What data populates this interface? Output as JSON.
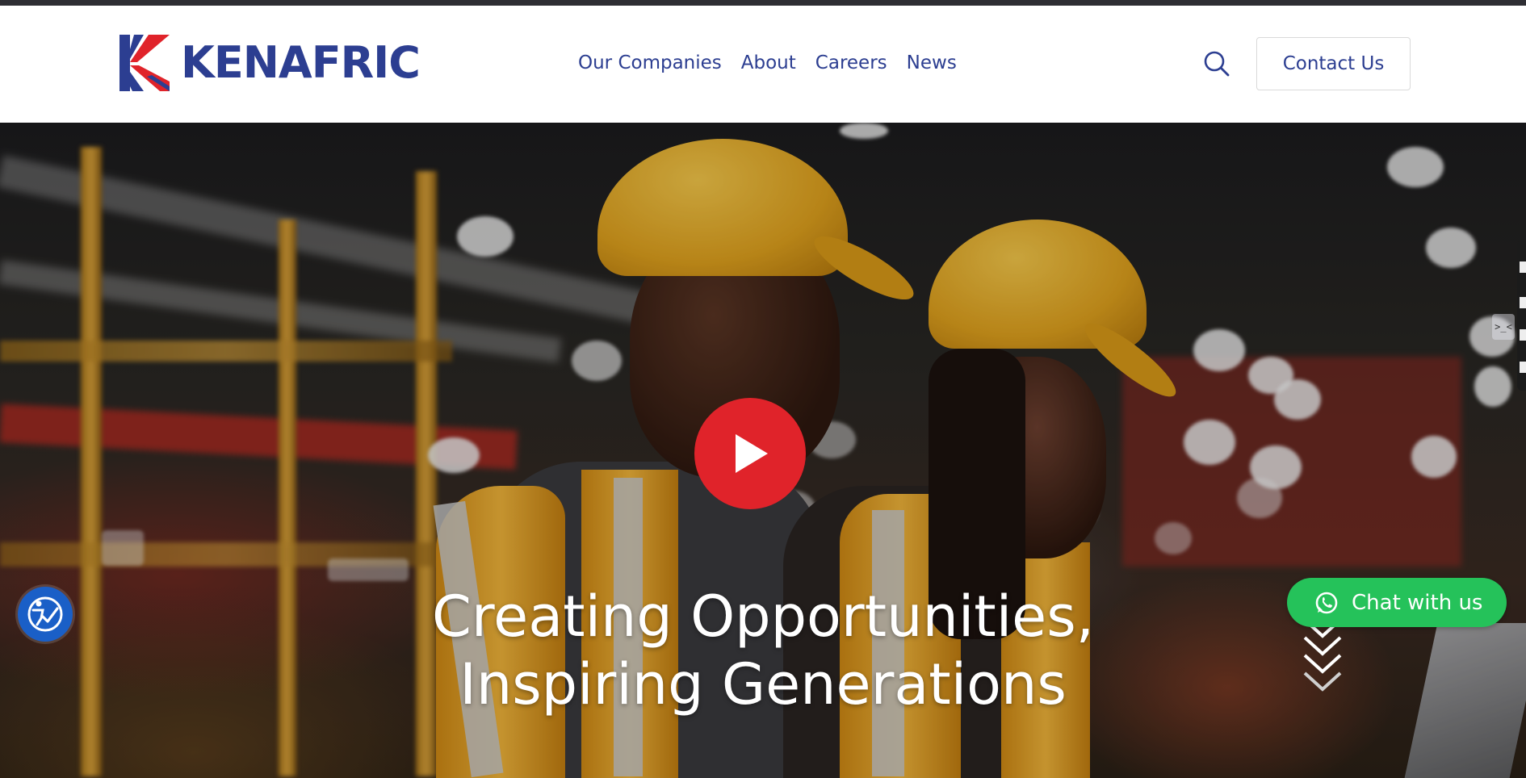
{
  "brand": {
    "name": "KENAFRIC",
    "primary_color": "#2c3e91",
    "accent_color": "#e0232a"
  },
  "nav": {
    "items": [
      {
        "label": "Our Companies"
      },
      {
        "label": "About"
      },
      {
        "label": "Careers"
      },
      {
        "label": "News"
      }
    ]
  },
  "header": {
    "search_icon": "search-icon",
    "contact_label": "Contact Us"
  },
  "hero": {
    "title_line1": "Creating Opportunities,",
    "title_line2": "Inspiring Generations",
    "play_icon": "play-icon",
    "scroll_icon": "chevrons-down-icon"
  },
  "chat": {
    "label": "Chat with us",
    "icon": "whatsapp-icon",
    "color": "#25c25a"
  },
  "accessibility": {
    "icon": "accessibility-icon",
    "color": "#1a5fc7"
  },
  "side_widget": {
    "label": ">_<"
  }
}
